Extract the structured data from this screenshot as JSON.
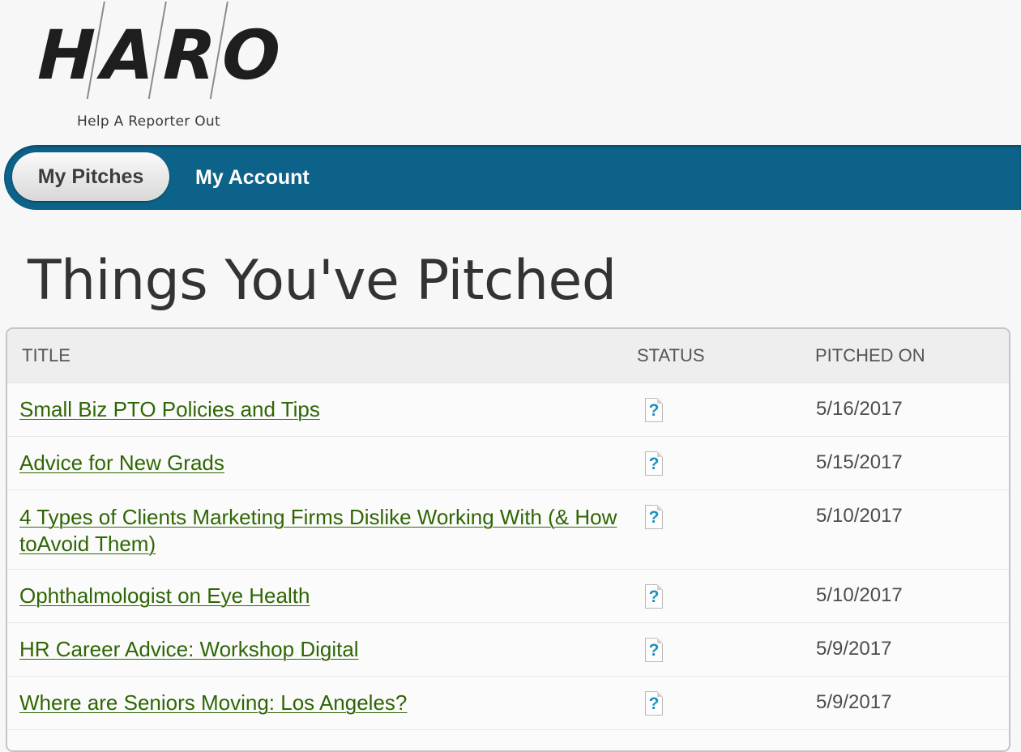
{
  "logo": {
    "letters": [
      "H",
      "A",
      "R",
      "O"
    ],
    "tagline": "Help A Reporter Out"
  },
  "nav": {
    "active_tab": "My Pitches",
    "other_tab": "My Account"
  },
  "page": {
    "title": "Things You've Pitched"
  },
  "table": {
    "headers": {
      "title": "TITLE",
      "status": "STATUS",
      "pitched_on": "PITCHED ON"
    },
    "rows": [
      {
        "title": "Small Biz PTO Policies and Tips",
        "status_icon": "question-doc-icon",
        "date": "5/16/2017"
      },
      {
        "title": "Advice for New Grads",
        "status_icon": "question-doc-icon",
        "date": "5/15/2017"
      },
      {
        "title": "4 Types of Clients Marketing Firms Dislike Working With (& How toAvoid Them)",
        "status_icon": "question-doc-icon",
        "date": "5/10/2017"
      },
      {
        "title": "Ophthalmologist on Eye Health",
        "status_icon": "question-doc-icon",
        "date": "5/10/2017"
      },
      {
        "title": "HR Career Advice: Workshop Digital",
        "status_icon": "question-doc-icon",
        "date": "5/9/2017"
      },
      {
        "title": "Where are Seniors Moving: Los Angeles?",
        "status_icon": "question-doc-icon",
        "date": "5/9/2017"
      },
      {
        "title": "",
        "status_icon": "",
        "date": ""
      }
    ]
  },
  "colors": {
    "nav_bar": "#0d6289",
    "link": "#2f6604",
    "status_icon": "#1e8fbf"
  }
}
